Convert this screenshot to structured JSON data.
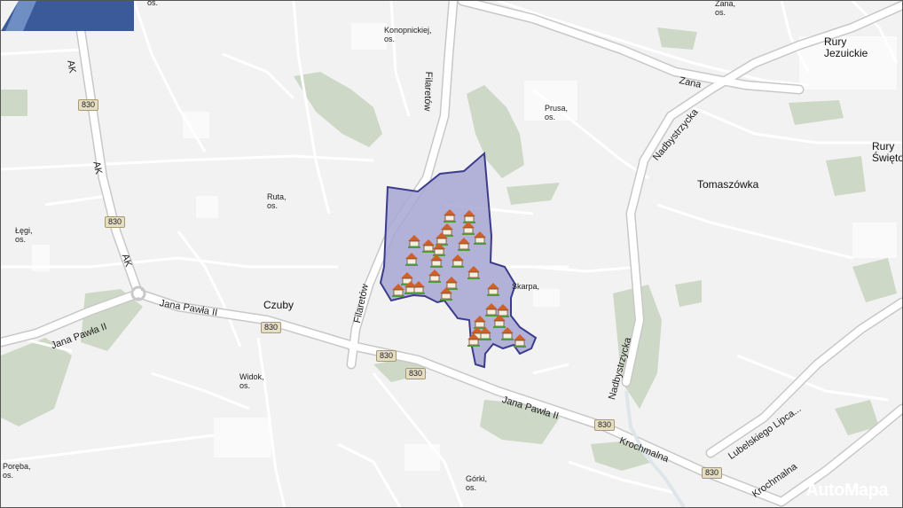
{
  "places_small": [
    {
      "key": "konopnickiej",
      "text": "Konopnickiej,\nos."
    },
    {
      "key": "zana_os",
      "text": "Zana,\nos."
    },
    {
      "key": "prusa",
      "text": "Prusa,\nos."
    },
    {
      "key": "ruta",
      "text": "Ruta,\nos."
    },
    {
      "key": "legi",
      "text": "Łęgi,\nos."
    },
    {
      "key": "widok",
      "text": "Widok,\nos."
    },
    {
      "key": "poreba",
      "text": "Poręba,\nos."
    },
    {
      "key": "gorki",
      "text": "Górki,\nos."
    },
    {
      "key": "skarpa",
      "text": "Skarpa,"
    },
    {
      "key": "os_top",
      "text": "os."
    }
  ],
  "places_big": {
    "rury_jezuickie": "Rury\nJezuickie",
    "rury_swieto": "Rury\nŚwięto",
    "tomaszowka": "Tomaszówka",
    "czuby": "Czuby"
  },
  "roads": {
    "filaretow_n": "Filaretów",
    "filaretow_s": "Filaretów",
    "zana": "Zana",
    "nadbystrzycka_n": "Nadbystrzycka",
    "nadbystrzycka_s": "Nadbystrzycka",
    "jana_pawla_1": "Jana Pawła II",
    "jana_pawla_2": "Jana Pawła II",
    "jana_pawla_3": "Jana Pawła II",
    "ak_1": "AK",
    "ak_2": "AK",
    "ak_3": "AK",
    "krochmalna_1": "Krochmalna",
    "krochmalna_2": "Krochmalna",
    "lubelskiego": "Lubelskiego Lipca..."
  },
  "shields": [
    "830",
    "830",
    "830",
    "830",
    "830",
    "830",
    "830"
  ],
  "logo": "AutoMapa",
  "colors": {
    "background": "#f2f2f2",
    "road": "#ffffff",
    "green": "#cdd8c6",
    "district_fill": "#a7a7d3",
    "district_border": "#3c3c8c",
    "logo_bg": "#3b5a9a"
  },
  "house_icon": "house-icon"
}
